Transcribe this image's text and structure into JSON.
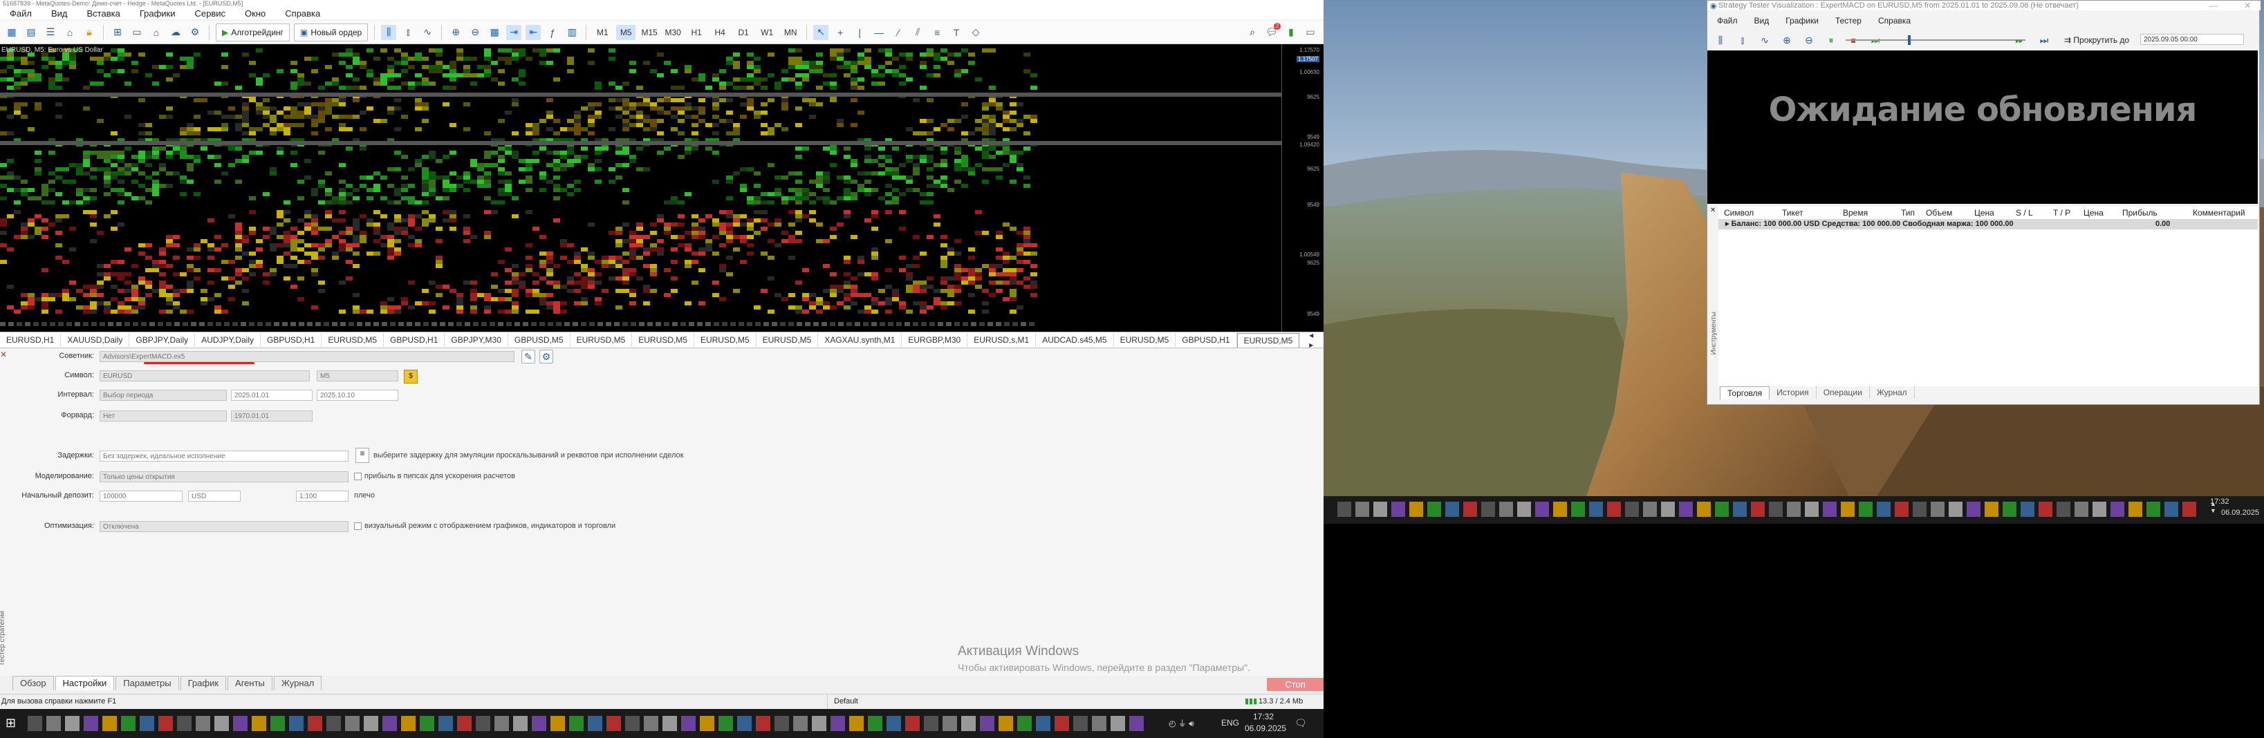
{
  "mt5": {
    "title": "51687839 - MetaQuotes-Demo: Демо-счет - Hedge - MetaQuotes Ltd. - [EURUSD,M5]",
    "menu": [
      "Файл",
      "Вид",
      "Вставка",
      "Графики",
      "Сервис",
      "Окно",
      "Справка"
    ],
    "toolbar": {
      "algo_label": "Алготрейдинг",
      "new_order_label": "Новый ордер",
      "timeframes": [
        "M1",
        "M5",
        "M15",
        "M30",
        "H1",
        "H4",
        "D1",
        "W1",
        "MN"
      ],
      "selected_timeframe": "M5",
      "notification_count": "2"
    },
    "chart": {
      "label": "EURUSD, M5:  Euro vs US Dollar",
      "prices": [
        "1.17570",
        "1.17507",
        "1.00630",
        "9625",
        "9549",
        "1.09420",
        "9625",
        "9549",
        "1.00549",
        "9625",
        "9549"
      ]
    },
    "tabs": [
      "EURUSD,H1",
      "XAUUSD,Daily",
      "GBPJPY,Daily",
      "AUDJPY,Daily",
      "GBPUSD,H1",
      "EURUSD,M5",
      "GBPUSD,H1",
      "GBPJPY,M30",
      "GBPUSD,M5",
      "EURUSD,M5",
      "EURUSD,M5",
      "EURUSD,M5",
      "EURUSD,M5",
      "XAGXAU.synth,M1",
      "EURGBP,M30",
      "EURUSD,s,M1",
      "AUDCAD.s45,M5",
      "EURUSD,M5",
      "GBPUSD,H1",
      "EURUSD,M5"
    ],
    "active_tab": "EURUSD,M5",
    "tester": {
      "advisor_label": "Советник:",
      "advisor_value": "Advisors\\ExpertMACD.ex5",
      "symbol_label": "Символ:",
      "symbol_value": "EURUSD",
      "symbol_tf": "M5",
      "interval_label": "Интервал:",
      "interval_value": "Выбор периода",
      "date_from": "2025.01.01",
      "date_to": "2025.10.10",
      "forward_label": "Форвард:",
      "forward_value": "Нет",
      "forward_date": "1970.01.01",
      "delays_label": "Задержки:",
      "delays_value": "Без задержек, идеальное исполнение",
      "delays_hint": "выберите задержку для эмуляции проскальзываний и реквотов при исполнении сделок",
      "model_label": "Моделирование:",
      "model_value": "Только цены открытия",
      "model_hint": "прибыль в пипсах для ускорения расчетов",
      "deposit_label": "Начальный депозит:",
      "deposit_value": "100000",
      "currency": "USD",
      "leverage": "1:100",
      "leverage_suffix": "плечо",
      "optim_label": "Оптимизация:",
      "optim_value": "Отключена",
      "visual_hint": "визуальный режим с отображением графиков, индикаторов и торговли",
      "side_label": "Тестер стратегий"
    },
    "bottom_tabs": [
      "Обзор",
      "Настройки",
      "Параметры",
      "График",
      "Агенты",
      "Журнал"
    ],
    "active_bottom_tab": "Настройки",
    "stop_label": "Стоп",
    "windows_activation": "Активация Windows",
    "windows_activation_hint": "Чтобы активировать Windows, перейдите в раздел \"Параметры\".",
    "status": {
      "help": "Для вызова справки нажмите F1",
      "profile": "Default",
      "traffic": "13.3 / 2.4 Mb"
    },
    "taskbar_time": "17:32",
    "taskbar_date": "06.09.2025",
    "taskbar_lang": "ENG"
  },
  "stv": {
    "title": "Strategy Tester Visualization : ExpertMACD on EURUSD,M5 from 2025.01.01 to 2025.09.06 (Не отвечает)",
    "menu": [
      "Файл",
      "Вид",
      "Графики",
      "Тестер",
      "Справка"
    ],
    "scroll_label": "Прокрутить до",
    "scroll_date": "2025.09.05 00:00",
    "waiting": "Ожидание обновления",
    "columns": [
      "Символ",
      "Тикет",
      "Время",
      "Тип",
      "Объем",
      "Цена",
      "S / L",
      "T / P",
      "Цена",
      "Прибыль",
      "Комментарий"
    ],
    "balance_row": "Баланс: 100 000.00 USD  Средства: 100 000.00  Свободная маржа: 100 000.00",
    "balance_profit": "0.00",
    "tabs": [
      "Торговля",
      "История",
      "Операции",
      "Журнал"
    ],
    "active_tab": "Торговля",
    "side_label": "Инструменты"
  },
  "desktop": {
    "time": "17:32",
    "date": "06.09.2025"
  }
}
